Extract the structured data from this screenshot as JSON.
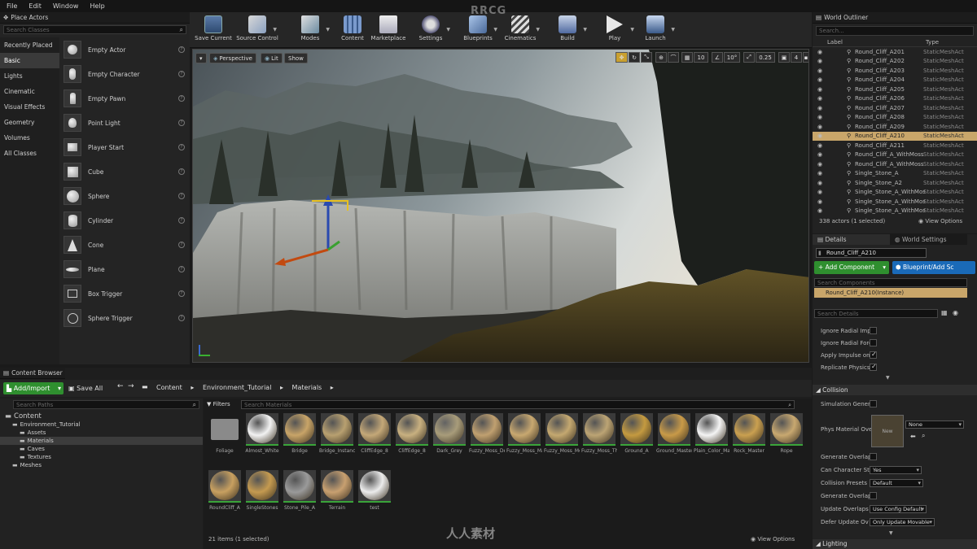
{
  "menu": [
    "File",
    "Edit",
    "Window",
    "Help"
  ],
  "watermark": "RRCG",
  "watermark_cn": "人人素材",
  "place_actors": {
    "tab": "Place Actors",
    "search_placeholder": "Search Classes",
    "categories": [
      "Recently Placed",
      "Basic",
      "Lights",
      "Cinematic",
      "Visual Effects",
      "Geometry",
      "Volumes",
      "All Classes"
    ],
    "selected_category": "Basic",
    "items": [
      "Empty Actor",
      "Empty Character",
      "Empty Pawn",
      "Point Light",
      "Player Start",
      "Cube",
      "Sphere",
      "Cylinder",
      "Cone",
      "Plane",
      "Box Trigger",
      "Sphere Trigger"
    ]
  },
  "toolbar": {
    "buttons": [
      "Save Current",
      "Source Control",
      "Modes",
      "Content",
      "Marketplace",
      "Settings",
      "Blueprints",
      "Cinematics",
      "Build",
      "Play",
      "Launch"
    ]
  },
  "viewport": {
    "perspective": "Perspective",
    "lit": "Lit",
    "show": "Show",
    "grid_snap": "10",
    "rot_snap": "10°",
    "scale_snap": "0.25",
    "cam_speed": "4"
  },
  "outliner": {
    "tab": "World Outliner",
    "search_placeholder": "Search...",
    "col_label": "Label",
    "col_type": "Type",
    "rows": [
      {
        "name": "Round_Cliff_A201",
        "type": "StaticMeshAct"
      },
      {
        "name": "Round_Cliff_A202",
        "type": "StaticMeshAct"
      },
      {
        "name": "Round_Cliff_A203",
        "type": "StaticMeshAct"
      },
      {
        "name": "Round_Cliff_A204",
        "type": "StaticMeshAct"
      },
      {
        "name": "Round_Cliff_A205",
        "type": "StaticMeshAct"
      },
      {
        "name": "Round_Cliff_A206",
        "type": "StaticMeshAct"
      },
      {
        "name": "Round_Cliff_A207",
        "type": "StaticMeshAct"
      },
      {
        "name": "Round_Cliff_A208",
        "type": "StaticMeshAct"
      },
      {
        "name": "Round_Cliff_A209",
        "type": "StaticMeshAct"
      },
      {
        "name": "Round_Cliff_A210",
        "type": "StaticMeshAct"
      },
      {
        "name": "Round_Cliff_A211",
        "type": "StaticMeshAct"
      },
      {
        "name": "Round_Cliff_A_WithMoss",
        "type": "StaticMeshAct"
      },
      {
        "name": "Round_Cliff_A_WithMoss",
        "type": "StaticMeshAct"
      },
      {
        "name": "Single_Stone_A",
        "type": "StaticMeshAct"
      },
      {
        "name": "Single_Stone_A2",
        "type": "StaticMeshAct"
      },
      {
        "name": "Single_Stone_A_WithMoss",
        "type": "StaticMeshAct"
      },
      {
        "name": "Single_Stone_A_WithMoss",
        "type": "StaticMeshAct"
      },
      {
        "name": "Single_Stone_A_WithMoss",
        "type": "StaticMeshAct"
      }
    ],
    "status": "338 actors (1 selected)",
    "view_options": "View Options"
  },
  "details": {
    "tab": "Details",
    "tab2": "World Settings",
    "name_value": "Round_Cliff_A210",
    "add_component": "+ Add Component",
    "blueprint": "Blueprint/Add Sc",
    "search_components": "Search Components",
    "instance": "Round_Cliff_A210(Instance)",
    "search_details": "Search Details",
    "props_top": [
      {
        "label": "Ignore Radial Imp",
        "checked": false
      },
      {
        "label": "Ignore Radial Forc",
        "checked": false
      },
      {
        "label": "Apply Impulse on",
        "checked": true
      },
      {
        "label": "Replicate Physics",
        "checked": true
      }
    ],
    "collision_header": "Collision",
    "sim_gen": "Simulation Gener",
    "phys_mat": "Phys Material Ove",
    "phys_none": "None",
    "gen_overlap": "Generate Overlap",
    "can_char": "Can Character Ste",
    "can_char_val": "Yes",
    "coll_presets": "Collision Presets",
    "coll_presets_val": "Default",
    "gen_overlap2": "Generate Overlap",
    "update_overlaps": "Update Overlaps M",
    "update_overlaps_val": "Use Config Default",
    "defer_update": "Defer Update Ov",
    "defer_update_val": "Only Update Movable",
    "lighting_header": "Lighting"
  },
  "content_browser": {
    "tab": "Content Browser",
    "add_import": "Add/Import",
    "save_all": "Save All",
    "breadcrumb": [
      "Content",
      "Environment_Tutorial",
      "Materials"
    ],
    "search_paths": "Search Paths",
    "filters": "Filters",
    "search_materials": "Search Materials",
    "tree": [
      {
        "label": "Content",
        "indent": 0
      },
      {
        "label": "Environment_Tutorial",
        "indent": 1
      },
      {
        "label": "Assets",
        "indent": 2
      },
      {
        "label": "Materials",
        "indent": 2
      },
      {
        "label": "Caves",
        "indent": 2
      },
      {
        "label": "Textures",
        "indent": 2
      },
      {
        "label": "Meshes",
        "indent": 1
      }
    ],
    "assets_row1": [
      "Foliage",
      "Almost_White",
      "Bridge",
      "Bridge_Instance",
      "CliffEdge_8",
      "CliffEdge_8",
      "Dark_Grey",
      "Fuzzy_Moss_Dense",
      "Fuzzy_Moss_Master",
      "Fuzzy_Moss_Medium",
      "Fuzzy_Moss_Thin",
      "Ground_A",
      "Ground_Master",
      "Plain_Color_Master",
      "Rock_Master",
      "Rope"
    ],
    "assets_row2": [
      "RoundCliff_A",
      "SingleStones",
      "Stone_Pile_A",
      "Terrain",
      "test"
    ],
    "status": "21 items (1 selected)",
    "view_options": "View Options"
  }
}
